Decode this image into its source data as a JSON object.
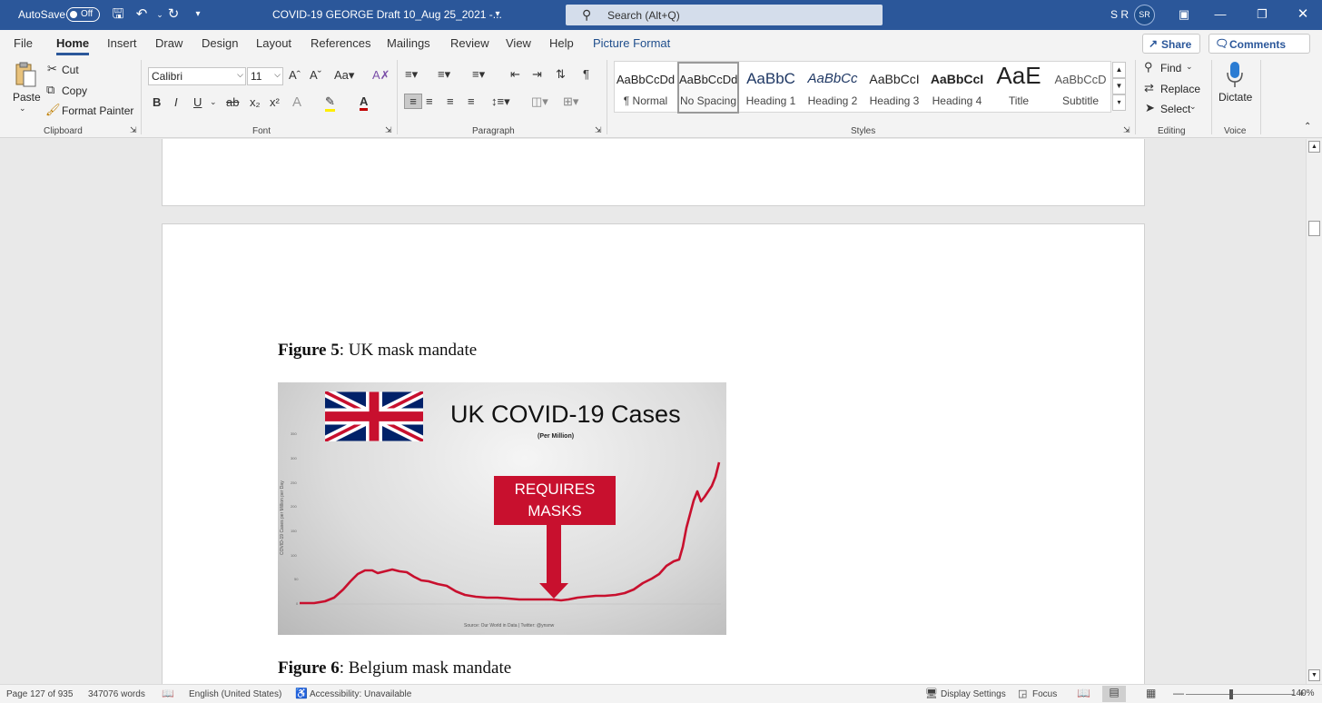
{
  "titlebar": {
    "autosave_label": "AutoSave",
    "autosave_state": "Off",
    "doc_title": "COVID-19 GEORGE Draft 10_Aug 25_2021  -...",
    "search_placeholder": "Search (Alt+Q)",
    "user_initials": "S R",
    "avatar_initials": "SR"
  },
  "menu": {
    "tabs": [
      "File",
      "Home",
      "Insert",
      "Draw",
      "Design",
      "Layout",
      "References",
      "Mailings",
      "Review",
      "View",
      "Help",
      "Picture Format"
    ],
    "share": "Share",
    "comments": "Comments"
  },
  "ribbon": {
    "clipboard": {
      "paste": "Paste",
      "cut": "Cut",
      "copy": "Copy",
      "format_painter": "Format Painter",
      "label": "Clipboard"
    },
    "font": {
      "name": "Calibri",
      "size": "11",
      "label": "Font"
    },
    "paragraph": {
      "label": "Paragraph"
    },
    "styles": {
      "label": "Styles",
      "items": [
        {
          "preview": "AaBbCcDd",
          "name": "¶ Normal"
        },
        {
          "preview": "AaBbCcDd",
          "name": "No Spacing"
        },
        {
          "preview": "AaBbC",
          "name": "Heading 1"
        },
        {
          "preview": "AaBbCc",
          "name": "Heading 2"
        },
        {
          "preview": "AaBbCcI",
          "name": "Heading 3"
        },
        {
          "preview": "AaBbCcI",
          "name": "Heading 4"
        },
        {
          "preview": "AaE",
          "name": "Title"
        },
        {
          "preview": "AaBbCcD",
          "name": "Subtitle"
        }
      ]
    },
    "editing": {
      "find": "Find",
      "replace": "Replace",
      "select": "Select",
      "label": "Editing"
    },
    "voice": {
      "dictate": "Dictate",
      "label": "Voice"
    }
  },
  "document": {
    "figure5_label": "Figure 5",
    "figure5_caption": ": UK mask mandate",
    "figure6_label": "Figure 6",
    "figure6_caption": ": Belgium mask mandate",
    "chart_title": "UK COVID-19 Cases",
    "chart_subtitle": "(Per Million)",
    "chart_callout": [
      "REQUIRES",
      "MASKS"
    ],
    "chart_ylabel": "COVID-19 Cases per Million per Day",
    "chart_source": "Source: Our World in Data | Twitter: @ynsnw",
    "chart_yticks": [
      "350",
      "300",
      "250",
      "200",
      "150",
      "100",
      "50",
      "0"
    ]
  },
  "statusbar": {
    "page": "Page 127 of 935",
    "words": "347076 words",
    "language": "English (United States)",
    "accessibility": "Accessibility: Unavailable",
    "display_settings": "Display Settings",
    "focus": "Focus",
    "zoom": "140%"
  },
  "colors": {
    "title_bar": "#2b579a",
    "chart_line": "#c8102e"
  }
}
